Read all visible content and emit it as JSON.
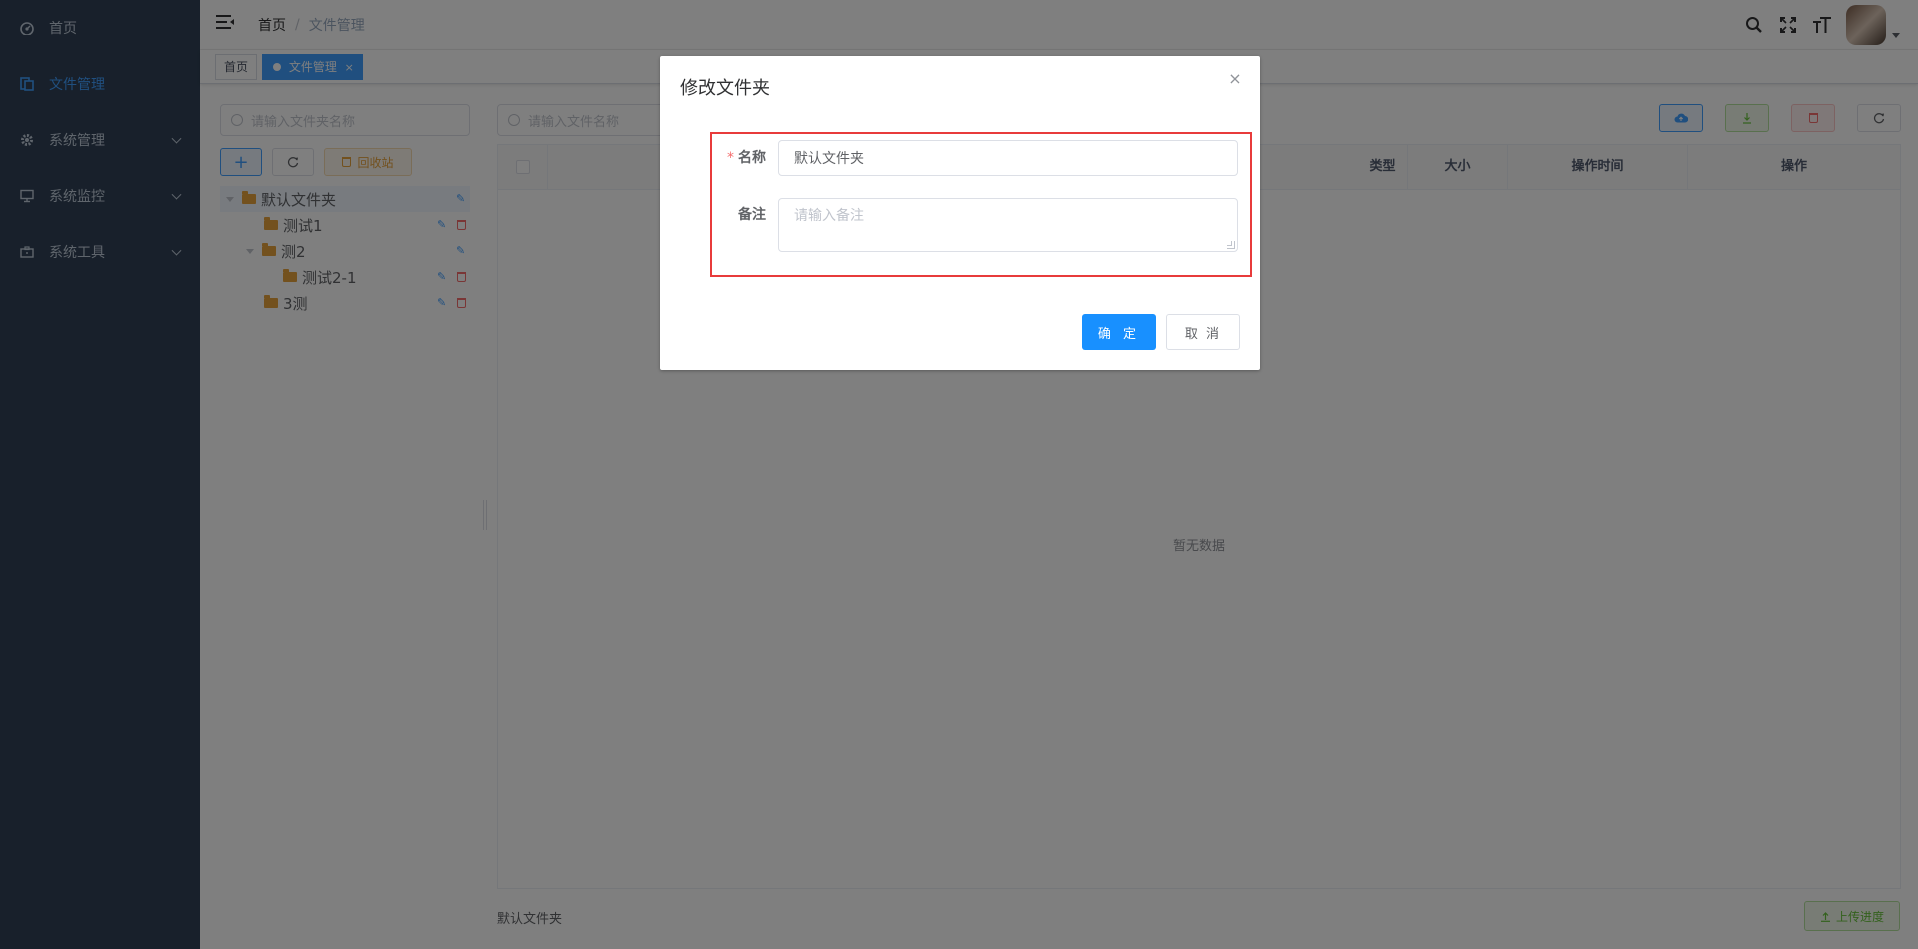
{
  "sidebar": {
    "items": [
      {
        "label": "首页",
        "icon": "dashboard-icon"
      },
      {
        "label": "文件管理",
        "icon": "documentation-icon",
        "active": true
      },
      {
        "label": "系统管理",
        "icon": "gear-icon",
        "expandable": true
      },
      {
        "label": "系统监控",
        "icon": "monitor-icon",
        "expandable": true
      },
      {
        "label": "系统工具",
        "icon": "toolbox-icon",
        "expandable": true
      }
    ]
  },
  "navbar": {
    "breadcrumb": [
      "首页",
      "文件管理"
    ],
    "icons": [
      "search-icon",
      "fullscreen-icon",
      "font-size-icon"
    ]
  },
  "tags": [
    {
      "label": "首页",
      "active": false
    },
    {
      "label": "文件管理",
      "active": true,
      "close": "×"
    }
  ],
  "folders": {
    "search_placeholder": "请输入文件夹名称",
    "recycle_label": "回收站",
    "tree": [
      {
        "label": "默认文件夹",
        "level": 0,
        "expanded": true,
        "current": true
      },
      {
        "label": "测试1",
        "level": 1
      },
      {
        "label": "测2",
        "level": 1,
        "expanded": true
      },
      {
        "label": "测试2-1",
        "level": 2
      },
      {
        "label": "3测",
        "level": 1
      }
    ]
  },
  "files": {
    "search_placeholder": "请输入文件名称",
    "columns": [
      "类型",
      "大小",
      "操作时间",
      "操作"
    ],
    "empty_text": "暂无数据",
    "current_folder": "默认文件夹",
    "progress_label": "上传进度"
  },
  "dialog": {
    "title": "修改文件夹",
    "name_label": "名称",
    "name_value": "默认文件夹",
    "remark_label": "备注",
    "remark_placeholder": "请输入备注",
    "confirm_label": "确 定",
    "cancel_label": "取 消"
  },
  "colors": {
    "sidebar_bg": "#304156",
    "primary": "#1890ff",
    "highlight_border": "#e83b3b"
  }
}
